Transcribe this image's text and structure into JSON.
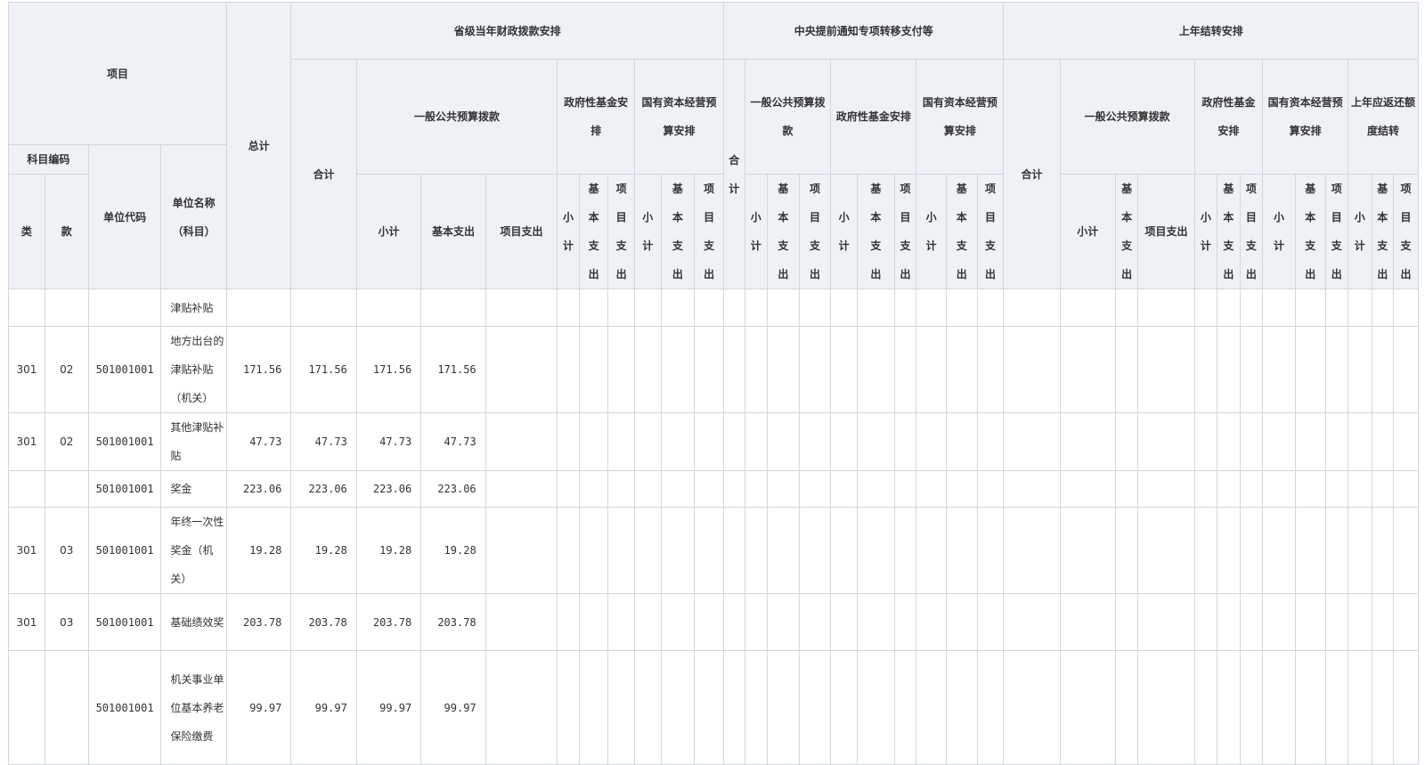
{
  "header": {
    "xiangmu": "项目",
    "kemu_bianma": "科目编码",
    "lei": "类",
    "kuan": "款",
    "danwei_daima": "单位代码",
    "danwei_mingcheng": "单位名称（科目）",
    "zongji": "总计",
    "group1": {
      "title": "省级当年财政拨款安排",
      "heji": "合计",
      "yiban": "一般公共预算拨款",
      "xiaoji": "小计",
      "jiben": "基本支出",
      "xiangmu": "项目支出",
      "zhengfu": "政府性基金安排",
      "guoyou": "国有资本经营预算安排",
      "sub_xiaoji": "小计",
      "sub_jiben": "基本支出",
      "sub_xiangmu": "项目支出"
    },
    "group2": {
      "title": "中央提前通知专项转移支付等",
      "heji": "合计",
      "yiban": "一般公共预算拨款",
      "zhengfu": "政府性基金安排",
      "guoyou": "国有资本经营预算安排",
      "sub_xiaoji": "小计",
      "sub_jiben": "基本支出",
      "sub_xiangmu": "项目支出"
    },
    "group3": {
      "title": "上年结转安排",
      "heji": "合计",
      "yiban": "一般公共预算拨款",
      "xiaoji": "小计",
      "jiben": "基本支出",
      "xiangmu": "项目支出",
      "zhengfu": "政府性基金安排",
      "guoyou": "国有资本经营预算安排",
      "shangnian": "上年应返还额度结转",
      "sub_xiaoji": "小计",
      "sub_jiben": "基本支出",
      "sub_xiangmu": "项目支出"
    }
  },
  "rows": [
    {
      "lei": "",
      "kuan": "",
      "code": "",
      "name": "津贴补贴",
      "zongji": "",
      "heji": "",
      "xiaoji": "",
      "jiben": ""
    },
    {
      "lei": "301",
      "kuan": "02",
      "code": "501001001",
      "name": "地方出台的津贴补贴（机关）",
      "zongji": "171.56",
      "heji": "171.56",
      "xiaoji": "171.56",
      "jiben": "171.56"
    },
    {
      "lei": "301",
      "kuan": "02",
      "code": "501001001",
      "name": "其他津贴补贴",
      "zongji": "47.73",
      "heji": "47.73",
      "xiaoji": "47.73",
      "jiben": "47.73"
    },
    {
      "lei": "",
      "kuan": "",
      "code": "501001001",
      "name": "奖金",
      "zongji": "223.06",
      "heji": "223.06",
      "xiaoji": "223.06",
      "jiben": "223.06"
    },
    {
      "lei": "301",
      "kuan": "03",
      "code": "501001001",
      "name": "年终一次性奖金（机关）",
      "zongji": "19.28",
      "heji": "19.28",
      "xiaoji": "19.28",
      "jiben": "19.28"
    },
    {
      "lei": "301",
      "kuan": "03",
      "code": "501001001",
      "name": "基础绩效奖",
      "zongji": "203.78",
      "heji": "203.78",
      "xiaoji": "203.78",
      "jiben": "203.78"
    },
    {
      "lei": "",
      "kuan": "",
      "code": "501001001",
      "name": "机关事业单位基本养老保险缴费",
      "zongji": "99.97",
      "heji": "99.97",
      "xiaoji": "99.97",
      "jiben": "99.97"
    }
  ]
}
